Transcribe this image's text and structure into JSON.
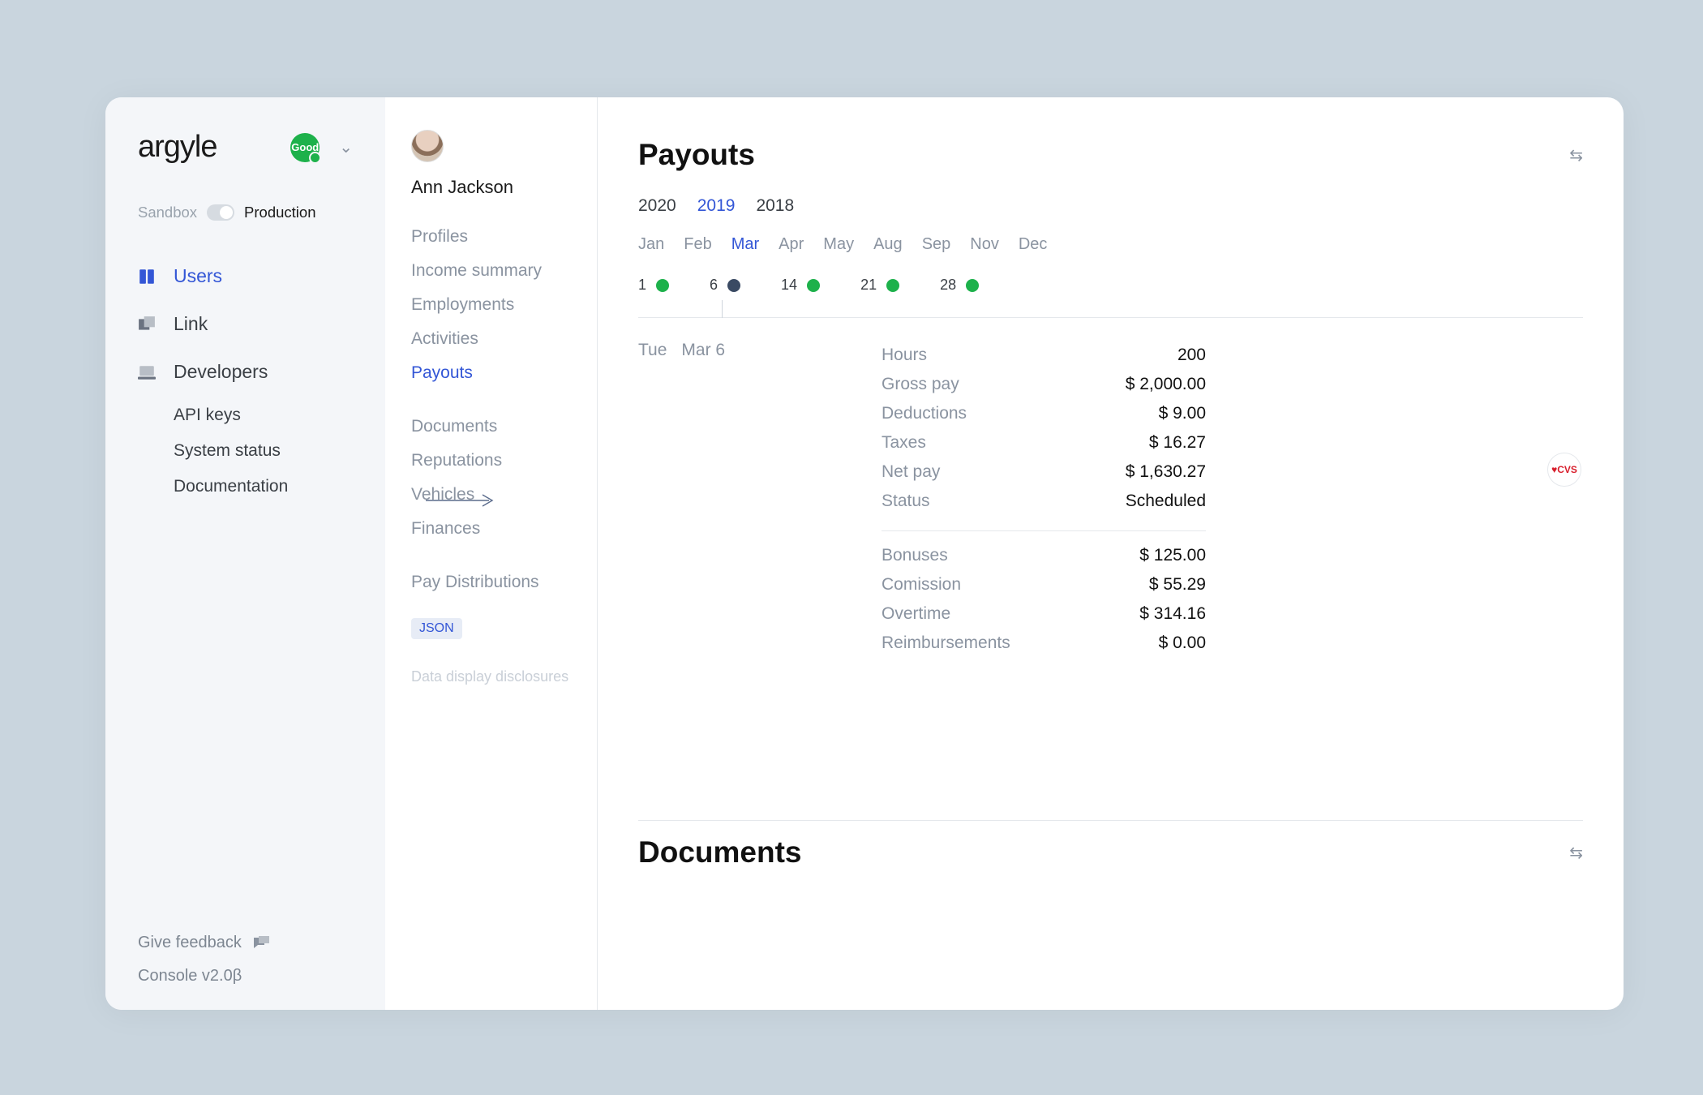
{
  "brand": {
    "name": "argyle",
    "badge": "Good"
  },
  "env": {
    "sandbox": "Sandbox",
    "production": "Production"
  },
  "nav": {
    "users": "Users",
    "link": "Link",
    "developers": "Developers",
    "api_keys": "API keys",
    "system_status": "System status",
    "documentation": "Documentation"
  },
  "footer": {
    "feedback": "Give feedback",
    "version": "Console v2.0β"
  },
  "user": {
    "name": "Ann Jackson"
  },
  "midnav": {
    "profiles": "Profiles",
    "income_summary": "Income summary",
    "employments": "Employments",
    "activities": "Activities",
    "payouts": "Payouts",
    "documents": "Documents",
    "reputations": "Reputations",
    "vehicles": "Vehicles",
    "finances": "Finances",
    "pay_distributions": "Pay Distributions",
    "json_badge": "JSON",
    "disclosures": "Data display disclosures"
  },
  "payouts": {
    "title": "Payouts",
    "years": [
      "2020",
      "2019",
      "2018"
    ],
    "year_active_index": 1,
    "months": [
      "Jan",
      "Feb",
      "Mar",
      "Apr",
      "May",
      "Aug",
      "Sep",
      "Nov",
      "Dec"
    ],
    "month_active_index": 2,
    "days": [
      {
        "num": "1",
        "dark": false
      },
      {
        "num": "6",
        "dark": true
      },
      {
        "num": "14",
        "dark": false
      },
      {
        "num": "21",
        "dark": false
      },
      {
        "num": "28",
        "dark": false
      }
    ],
    "selected": {
      "dow": "Tue",
      "date": "Mar 6",
      "rows_primary": [
        {
          "k": "Hours",
          "v": "200"
        },
        {
          "k": "Gross pay",
          "v": "$ 2,000.00"
        },
        {
          "k": "Deductions",
          "v": "$ 9.00"
        },
        {
          "k": "Taxes",
          "v": "$ 16.27"
        },
        {
          "k": "Net pay",
          "v": "$ 1,630.27"
        },
        {
          "k": "Status",
          "v": "Scheduled"
        }
      ],
      "rows_secondary": [
        {
          "k": "Bonuses",
          "v": "$ 125.00"
        },
        {
          "k": "Comission",
          "v": "$ 55.29"
        },
        {
          "k": "Overtime",
          "v": "$ 314.16"
        },
        {
          "k": "Reimbursements",
          "v": "$ 0.00"
        }
      ],
      "source_badge": "♥CVS"
    }
  },
  "documents": {
    "title": "Documents"
  }
}
